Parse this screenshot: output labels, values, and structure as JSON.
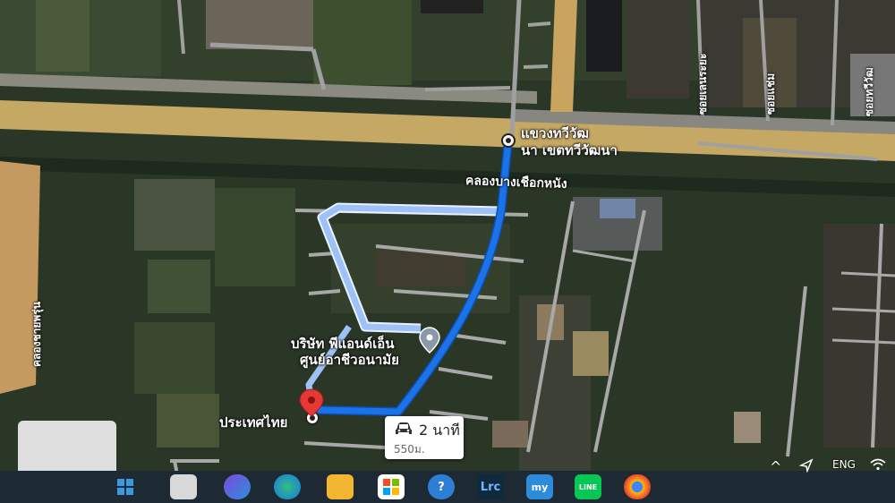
{
  "map": {
    "labels": {
      "subdistrict": "แขวงทวีวัฒ",
      "district": "นา เขตทวีวัฒนา",
      "canal": "คลองบางเชือกหนัง",
      "company_line1": "บริษัท พีแอนด์เอ็น",
      "company_line2": "ศูนย์อาชีวอนามัย",
      "country": "ประเทศไทย",
      "canal_left": "คลองชายพรุ่น",
      "road_v1": "ซอยเลนระยะ",
      "road_v2": "ซอยแช่ม",
      "road_v3": "ซอยทวีวัฒ"
    },
    "route": {
      "duration": "2 นาที",
      "distance": "550ม.",
      "color_primary": "#1a73e8",
      "color_alt": "#9ec2f7"
    }
  },
  "taskbar": {
    "icons": [
      {
        "name": "windows",
        "glyph": ""
      },
      {
        "name": "copilot",
        "glyph": ""
      },
      {
        "name": "edge",
        "glyph": ""
      },
      {
        "name": "file-explorer",
        "glyph": ""
      },
      {
        "name": "microsoft-store",
        "glyph": ""
      },
      {
        "name": "help",
        "glyph": "?"
      },
      {
        "name": "lightroom",
        "glyph": "Lrc"
      },
      {
        "name": "my-app",
        "glyph": "my"
      },
      {
        "name": "line",
        "glyph": "LINE"
      },
      {
        "name": "chrome",
        "glyph": ""
      }
    ],
    "tray": {
      "chevron": "^",
      "language": "ENG"
    }
  }
}
